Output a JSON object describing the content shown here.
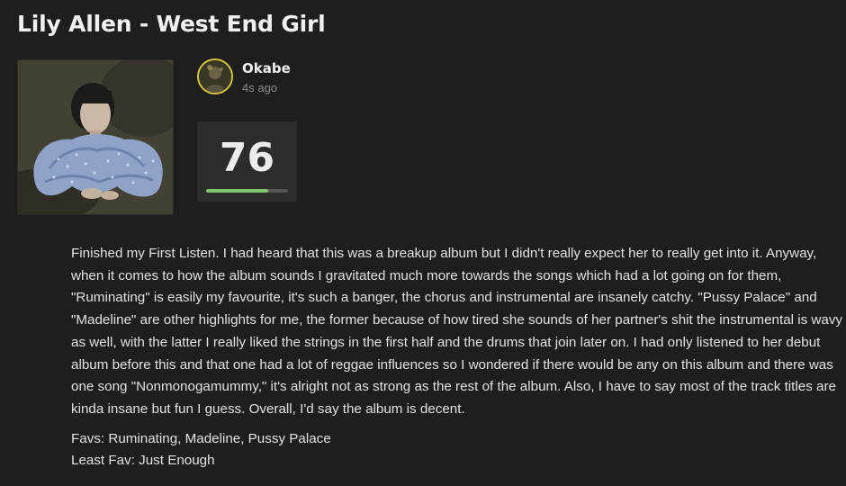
{
  "review": {
    "title": "Lily Allen - West End Girl",
    "cover_alt": "album-cover",
    "user": {
      "name": "Okabe",
      "timestamp": "4s ago"
    },
    "score": {
      "value": "76",
      "fraction": 0.76,
      "bar_color": "#7fc56a"
    },
    "text": "Finished my First Listen. I had heard that this was a breakup album but I didn't really expect her to really get into it. Anyway, when it comes to how the album sounds I gravitated much more towards the songs which had a lot going on for them, \"Ruminating\" is easily my favourite, it's such a banger, the chorus and instrumental are insanely catchy. \"Pussy Palace\" and \"Madeline\" are other highlights for me, the former because of how tired she sounds of her partner's shit the instrumental is wavy as well, with the latter I really liked the strings in the first half and the drums that join later on. I had only listened to her debut album before this and that one had a lot of reggae influences so I wondered if there would be any on this album and there was one song \"Nonmonogamummy,\" it's alright not as strong as the rest of the album. Also, I have to say most of the track titles are kinda insane but fun I guess. Overall, I'd say the album is decent.",
    "favs": "Favs: Ruminating, Madeline, Pussy Palace",
    "least_fav": "Least Fav: Just Enough"
  },
  "theme": {
    "background": "#1e1e1e",
    "score_box": "#2c2c2c",
    "avatar_ring": "#d6c835"
  }
}
